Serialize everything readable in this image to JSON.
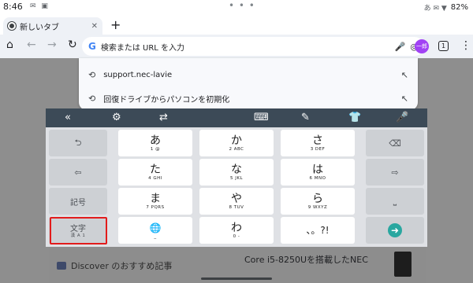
{
  "status_bar": {
    "time": "8:46",
    "left_icons": "✉ ▣",
    "center_dots": "• • •",
    "right_icons": "あ ✉ ▼",
    "battery": "82%"
  },
  "tabs": [
    {
      "title": "新しいタブ",
      "close": "✕"
    }
  ],
  "new_tab_label": "+",
  "toolbar": {
    "home_icon": "⌂",
    "back_icon": "←",
    "forward_icon": "→",
    "reload_icon": "↻",
    "google_logo": "G",
    "omnibox_placeholder": "検索または URL を入力",
    "mic_icon": "🎤",
    "lens_icon": "◎",
    "profile_initials": "一郎",
    "tab_count": "1",
    "menu_icon": "⋮"
  },
  "suggestions": [
    {
      "icon": "⟲",
      "text": "support.nec-lavie",
      "arrow": "↖"
    },
    {
      "icon": "⟲",
      "text": "回復ドライブからパソコンを初期化",
      "arrow": "↖"
    }
  ],
  "page": {
    "news_left": "Discover のおすすめ記事",
    "news_right": "Core i5-8250Uを搭載したNEC"
  },
  "keyboard": {
    "toolbar": {
      "collapse_icon": "«",
      "settings_icon": "⚙",
      "switch_icon": "⇄",
      "keyboard_icon": "⌨",
      "dictionary_icon": "✎",
      "clothes_icon": "👕",
      "mic_icon": "🎤"
    },
    "left_keys": [
      {
        "glyph": "⮌"
      },
      {
        "glyph": "⇦"
      },
      {
        "label": "記号"
      },
      {
        "label": "文字",
        "sub": "漢 A 1"
      }
    ],
    "right_keys": [
      {
        "glyph": "⌫"
      },
      {
        "glyph": "⇨"
      },
      {
        "glyph": "⎵"
      },
      {
        "glyph": "➜"
      }
    ],
    "rows": [
      [
        {
          "kana": "あ",
          "sub": "1   @"
        },
        {
          "kana": "か",
          "sub": "2 ABC"
        },
        {
          "kana": "さ",
          "sub": "3 DEF"
        }
      ],
      [
        {
          "kana": "た",
          "sub": "4 GHI"
        },
        {
          "kana": "な",
          "sub": "5 JKL"
        },
        {
          "kana": "は",
          "sub": "6 MNO"
        }
      ],
      [
        {
          "kana": "ま",
          "sub": "7 PQRS"
        },
        {
          "kana": "や",
          "sub": "8 TUV"
        },
        {
          "kana": "ら",
          "sub": "9 WXYZ"
        }
      ],
      [
        {
          "kana": "🌐",
          "sub": "_"
        },
        {
          "kana": "わ",
          "sub": "0   -"
        },
        {
          "kana": "、。?!",
          "sub": ""
        }
      ]
    ]
  },
  "colors": {
    "kb_toolbar": "#3c4a57",
    "enter_key": "#29a7a0",
    "highlight_box": "#e21b1b"
  }
}
